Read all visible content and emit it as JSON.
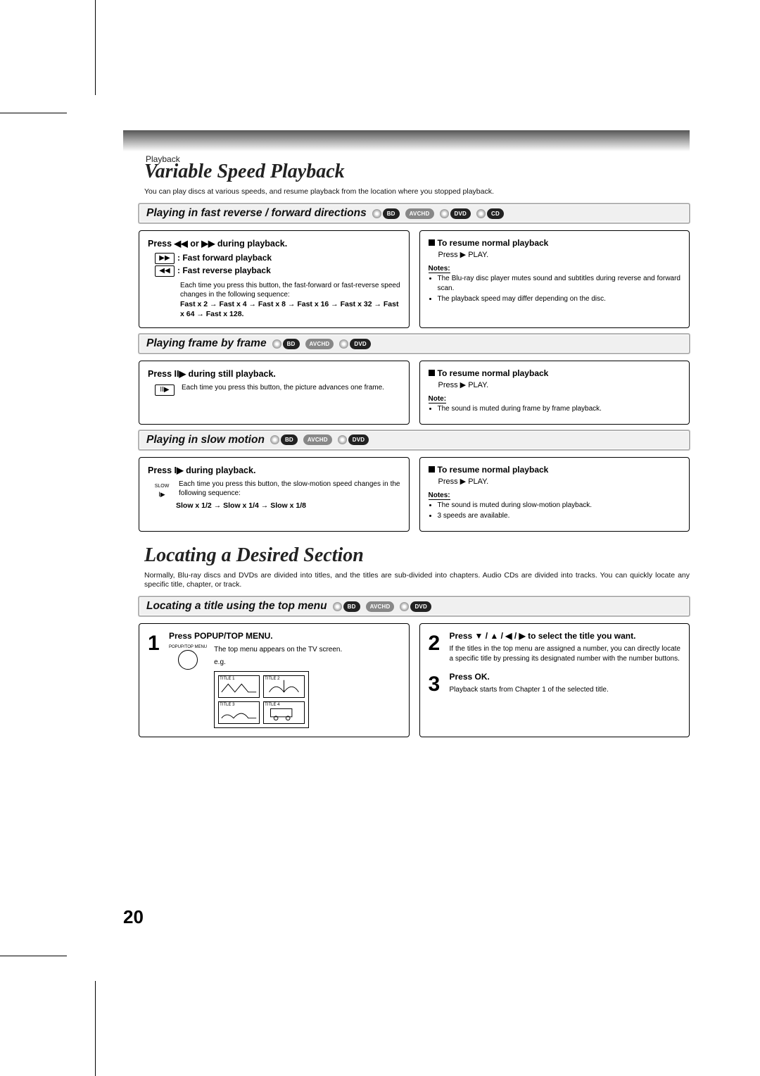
{
  "header": {
    "tab": "Playback"
  },
  "page_number": "20",
  "sec1": {
    "title": "Variable Speed Playback",
    "intro": "You can play discs at various speeds, and resume playback from the location where you stopped playback.",
    "sub1": {
      "bar": "Playing in fast reverse / forward directions",
      "badges": [
        "BD",
        "AVCHD",
        "DVD",
        "CD"
      ],
      "left": {
        "head": "Press ◀◀ or ▶▶ during playback.",
        "ff_icon": "▶▶",
        "ff_label": ": Fast forward playback",
        "fr_icon": "◀◀",
        "fr_label": ": Fast reverse playback",
        "desc": "Each time you press this button, the fast-forward or fast-reverse speed changes in the following sequence:",
        "seq": "Fast x 2 → Fast x 4 → Fast x 8 → Fast x 16 → Fast x 32 → Fast x 64 → Fast x 128."
      },
      "right": {
        "resume_h": "To resume normal playback",
        "resume_b": "Press ▶ PLAY.",
        "notes_h": "Notes:",
        "n1": "The Blu-ray disc player mutes sound and subtitles during reverse and forward scan.",
        "n2": "The playback speed may differ depending on the disc."
      }
    },
    "sub2": {
      "bar": "Playing frame by frame",
      "badges": [
        "BD",
        "AVCHD",
        "DVD"
      ],
      "left": {
        "head": "Press II▶ during still playback.",
        "icon": "II▶",
        "desc": "Each time you press this button, the picture advances one frame."
      },
      "right": {
        "resume_h": "To resume normal playback",
        "resume_b": "Press ▶ PLAY.",
        "notes_h": "Note:",
        "n1": "The sound is muted during frame by frame playback."
      }
    },
    "sub3": {
      "bar": "Playing in slow motion",
      "badges": [
        "BD",
        "AVCHD",
        "DVD"
      ],
      "left": {
        "head": "Press I▶ during playback.",
        "icon_l1": "SLOW",
        "icon_l2": "I▶",
        "desc": "Each time you press this button, the slow-motion speed changes in the following sequence:",
        "seq": "Slow x 1/2  → Slow x 1/4 → Slow x 1/8"
      },
      "right": {
        "resume_h": "To resume normal playback",
        "resume_b": "Press ▶ PLAY.",
        "notes_h": "Notes:",
        "n1": "The sound is muted during slow-motion playback.",
        "n2": "3 speeds are available."
      }
    }
  },
  "sec2": {
    "title": "Locating a Desired Section",
    "intro": "Normally, Blu-ray discs and DVDs are divided into titles, and the titles are sub-divided into chapters. Audio CDs are divided into tracks. You can quickly locate any specific title, chapter, or track.",
    "sub1": {
      "bar": "Locating a title using the top menu",
      "badges": [
        "BD",
        "AVCHD",
        "DVD"
      ],
      "step1": {
        "num": "1",
        "h": "Press POPUP/TOP MENU.",
        "btn": "POPUP/TOP MENU",
        "desc": "The top menu appears on the TV screen.",
        "eg": "e.g.",
        "t1": "TITLE 1",
        "t2": "TITLE 2",
        "t3": "TITLE 3",
        "t4": "TITLE 4"
      },
      "step2": {
        "num": "2",
        "h": "Press ▼ / ▲ / ◀ / ▶ to select the title you want.",
        "desc": "If the titles in the top menu are assigned a number, you can directly locate a specific title by pressing its designated number with the number buttons."
      },
      "step3": {
        "num": "3",
        "h": "Press OK.",
        "desc": "Playback starts from Chapter 1 of the selected title."
      }
    }
  }
}
